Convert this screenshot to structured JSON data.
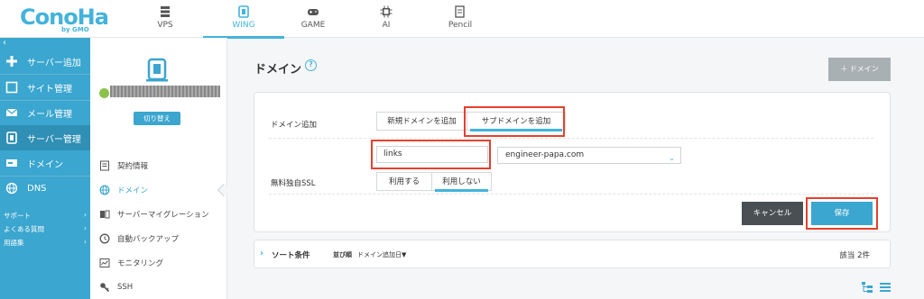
{
  "header": {
    "logo_text": "ConoHa",
    "logo_sub": "by GMO",
    "tabs": [
      {
        "label": "VPS",
        "icon": "server-rack-icon"
      },
      {
        "label": "WING",
        "icon": "wing-icon"
      },
      {
        "label": "GAME",
        "icon": "gamepad-icon"
      },
      {
        "label": "AI",
        "icon": "ai-chip-icon"
      },
      {
        "label": "Pencil",
        "icon": "pencil-doc-icon"
      }
    ],
    "active_tab": "WING"
  },
  "sidebar": {
    "collapse": "‹",
    "items": [
      {
        "label": "サーバー追加",
        "icon": "plus-icon"
      },
      {
        "label": "サイト管理",
        "icon": "site-icon"
      },
      {
        "label": "メール管理",
        "icon": "mail-icon"
      },
      {
        "label": "サーバー管理",
        "icon": "server-icon"
      },
      {
        "label": "ドメイン",
        "icon": "domain-icon"
      },
      {
        "label": "DNS",
        "icon": "globe-icon"
      }
    ],
    "links": [
      {
        "label": "サポート",
        "arrow": "›"
      },
      {
        "label": "よくある質問",
        "arrow": "›"
      },
      {
        "label": "用語集",
        "arrow": "›"
      }
    ]
  },
  "subbar": {
    "switch_label": "切り替え",
    "items": [
      {
        "label": "契約情報",
        "icon": "contract-icon"
      },
      {
        "label": "ドメイン",
        "icon": "globe-icon"
      },
      {
        "label": "サーバーマイグレーション",
        "icon": "migration-icon"
      },
      {
        "label": "自動バックアップ",
        "icon": "backup-icon"
      },
      {
        "label": "モニタリング",
        "icon": "monitoring-icon"
      },
      {
        "label": "SSH",
        "icon": "key-icon"
      }
    ]
  },
  "main": {
    "title": "ドメイン",
    "help": "?",
    "add_button": "＋ ドメイン",
    "form": {
      "domain_add_label": "ドメイン追加",
      "tab_new": "新規ドメインを追加",
      "tab_sub": "サブドメインを追加",
      "subdomain_value": "links",
      "domain_select": "engineer-papa.com",
      "ssl_label": "無料独自SSL",
      "ssl_use": "利用する",
      "ssl_nouse": "利用しない",
      "cancel": "キャンセル",
      "save": "保存"
    },
    "sort": {
      "label": "ソート条件",
      "order_label": "並び順",
      "order_value": "ドメイン追加日▼",
      "count": "該当 2件"
    }
  },
  "colors": {
    "brand": "#43b3dc",
    "sidebar": "#3ba6cf",
    "highlight": "#e4412f"
  }
}
